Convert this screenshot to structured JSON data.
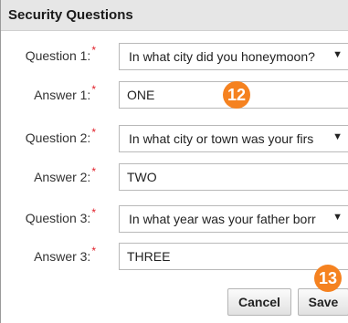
{
  "panel": {
    "title": "Security Questions"
  },
  "form": {
    "rows": [
      {
        "label": "Question 1:",
        "required_mark": "*",
        "value": "In what city did you honeymoon?"
      },
      {
        "label": "Answer 1:",
        "required_mark": "*",
        "value": "ONE"
      },
      {
        "label": "Question 2:",
        "required_mark": "*",
        "value": "In what city or town was your firs"
      },
      {
        "label": "Answer 2:",
        "required_mark": "*",
        "value": "TWO"
      },
      {
        "label": "Question 3:",
        "required_mark": "*",
        "value": "In what year was your father borr"
      },
      {
        "label": "Answer 3:",
        "required_mark": "*",
        "value": "THREE"
      }
    ],
    "caret": "▼"
  },
  "buttons": {
    "cancel_label": "Cancel",
    "save_label": "Save"
  },
  "badges": {
    "answer1_marker": "12",
    "save_marker": "13",
    "color": "#f58220"
  }
}
